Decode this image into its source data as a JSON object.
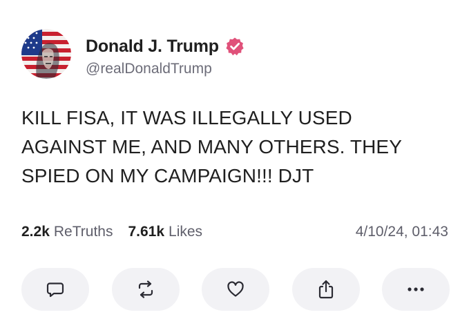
{
  "author": {
    "name": "Donald J. Trump",
    "handle": "@realDonaldTrump",
    "verified_icon": "verified-check-icon",
    "verified_color": "#e0517a"
  },
  "post": {
    "lines": [
      "KILL FISA, IT WAS ILLEGALLY USED",
      "AGAINST ME, AND MANY OTHERS. THEY",
      "SPIED ON MY CAMPAIGN!!! DJT"
    ]
  },
  "stats": {
    "retruths_count": "2.2k",
    "retruths_label": "ReTruths",
    "likes_count": "7.61k",
    "likes_label": "Likes",
    "timestamp": "4/10/24, 01:43"
  },
  "actions": [
    {
      "icon": "comment-icon"
    },
    {
      "icon": "retruth-icon"
    },
    {
      "icon": "heart-icon"
    },
    {
      "icon": "share-icon"
    },
    {
      "icon": "more-icon"
    }
  ],
  "colors": {
    "text": "#1f1f1f",
    "muted": "#5e5e6a",
    "action_bg": "#f2f2f5"
  }
}
